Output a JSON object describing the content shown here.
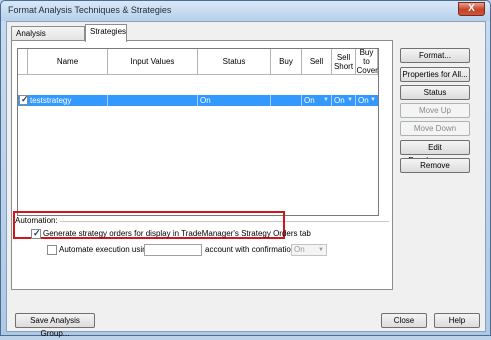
{
  "window": {
    "title": "Format Analysis Techniques & Strategies",
    "close_glyph": "X"
  },
  "tabs": [
    {
      "label": "Analysis Techniques"
    },
    {
      "label": "Strategies"
    }
  ],
  "grid": {
    "headers": [
      "Name",
      "Input Values",
      "Status",
      "Buy",
      "Sell",
      "Sell Short",
      "Buy to Cover"
    ],
    "row": {
      "name": "teststrategy",
      "input_values": "",
      "status": "On",
      "buy": "",
      "sell": "On",
      "sell_short": "On",
      "buy_to_cover": "On",
      "checked": true
    }
  },
  "side_buttons": {
    "format": "Format...",
    "properties": "Properties for All...",
    "status": "Status",
    "move_up": "Move Up",
    "move_down": "Move Down",
    "edit_easylanguage": "Edit EasyLanguage",
    "remove": "Remove"
  },
  "automation": {
    "group_label": "Automation:",
    "generate_orders_label": "Generate strategy orders for display in TradeManager's Strategy Orders tab",
    "generate_orders_checked": true,
    "automate_label": "Automate execution using",
    "automate_checked": false,
    "automate_account_value": "",
    "confirmation_label": "account with confirmation",
    "confirmation_value": "On"
  },
  "footer": {
    "save_group": "Save Analysis Group...",
    "close": "Close",
    "help": "Help"
  },
  "colors": {
    "selection": "#3399ff",
    "highlight_box": "#d0151d"
  }
}
